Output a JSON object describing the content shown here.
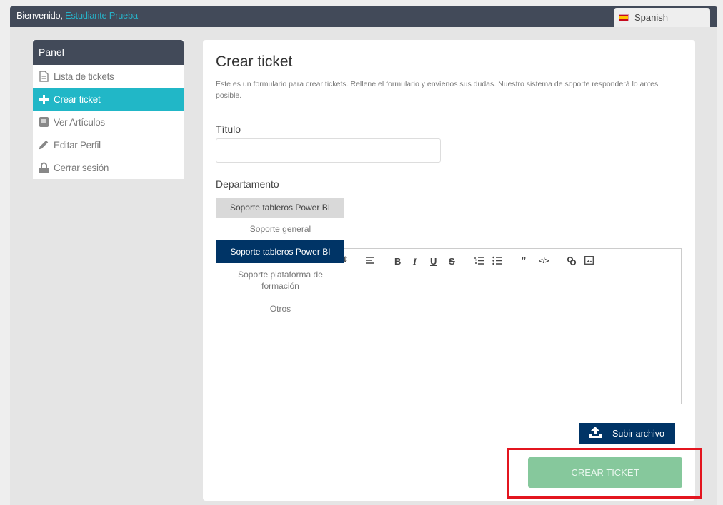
{
  "header": {
    "welcome": "Bienvenido,",
    "user_name": "Estudiante Prueba",
    "language": "Spanish",
    "language_icon": "spain-flag-icon"
  },
  "sidebar": {
    "title": "Panel",
    "items": [
      {
        "label": "Lista de tickets",
        "icon": "file-icon",
        "active": false
      },
      {
        "label": "Crear ticket",
        "icon": "plus-icon",
        "active": true
      },
      {
        "label": "Ver Artículos",
        "icon": "book-icon",
        "active": false
      },
      {
        "label": "Editar Perfil",
        "icon": "pencil-icon",
        "active": false
      },
      {
        "label": "Cerrar sesión",
        "icon": "lock-icon",
        "active": false
      }
    ]
  },
  "main": {
    "title": "Crear ticket",
    "description": "Este es un formulario para crear tickets. Rellene el formulario y envíenos sus dudas. Nuestro sistema de soporte responderá lo antes posible.",
    "title_label": "Título",
    "title_value": "",
    "department_label": "Departamento",
    "department_selected": "Soporte tableros Power BI",
    "department_options": [
      "Soporte general",
      "Soporte tableros Power BI",
      "Soporte plataforma de formación",
      "Otros"
    ],
    "editor_toolbar": [
      "size",
      "align",
      "bold",
      "italic",
      "underline",
      "strike",
      "ordered-list",
      "bullet-list",
      "blockquote",
      "code",
      "link",
      "image"
    ],
    "editor_content": "",
    "upload_label": "Subir archivo",
    "submit_label": "CREAR TICKET"
  },
  "colors": {
    "header_bg": "#424a59",
    "accent": "#21b7c7",
    "navy": "#003466",
    "submit": "#86c89c",
    "highlight": "#e3151f"
  }
}
